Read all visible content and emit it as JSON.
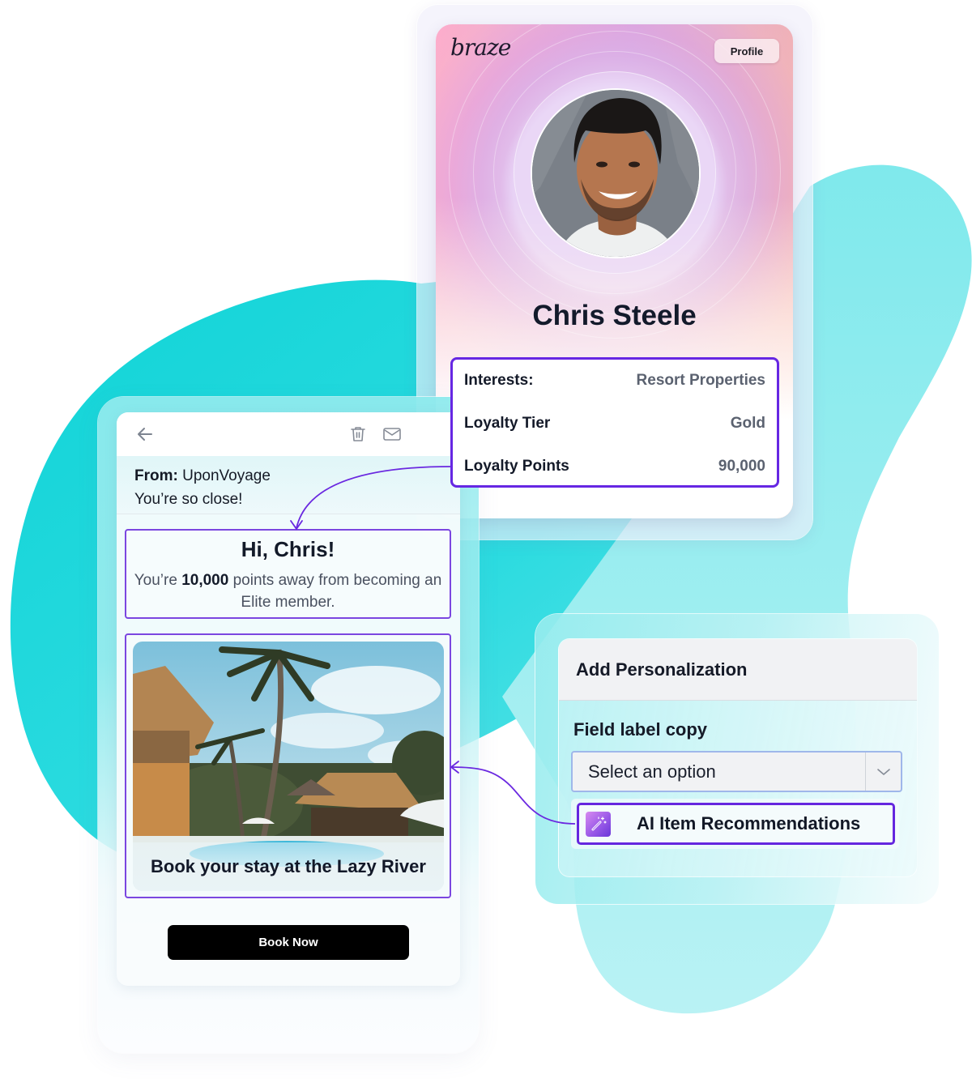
{
  "colors": {
    "accent_purple": "#6627E3",
    "teal_blob": "#16D7DB",
    "teal_light": "#9AEDEE",
    "button_black": "#000000"
  },
  "profile_card": {
    "brand": "braze",
    "profile_button": "Profile",
    "avatar_icon": "person-photo",
    "name": "Chris Steele",
    "attributes": [
      {
        "label": "Interests:",
        "value": "Resort Properties"
      },
      {
        "label": "Loyalty Tier",
        "value": "Gold"
      },
      {
        "label": "Loyalty Points",
        "value": "90,000"
      }
    ]
  },
  "email": {
    "toolbar": {
      "back_icon": "arrow-left-icon",
      "delete_icon": "trash-icon",
      "mail_icon": "envelope-icon"
    },
    "from_label": "From:",
    "from_value": "UponVoyage",
    "subject": "You’re so close!",
    "greeting": "Hi, Chris!",
    "body_prefix": "You’re",
    "body_points": "10,000",
    "body_suffix": "points away from becoming an Elite member.",
    "hero_image_alt": "tropical resort pool with palm trees and thatched huts",
    "hero_caption": "Book your stay at the Lazy River",
    "cta_button": "Book Now"
  },
  "personalization": {
    "title": "Add Personalization",
    "field_label": "Field label copy",
    "select_placeholder": "Select an option",
    "option_icon": "magic-wand-icon",
    "option_label": "AI Item Recommendations"
  }
}
